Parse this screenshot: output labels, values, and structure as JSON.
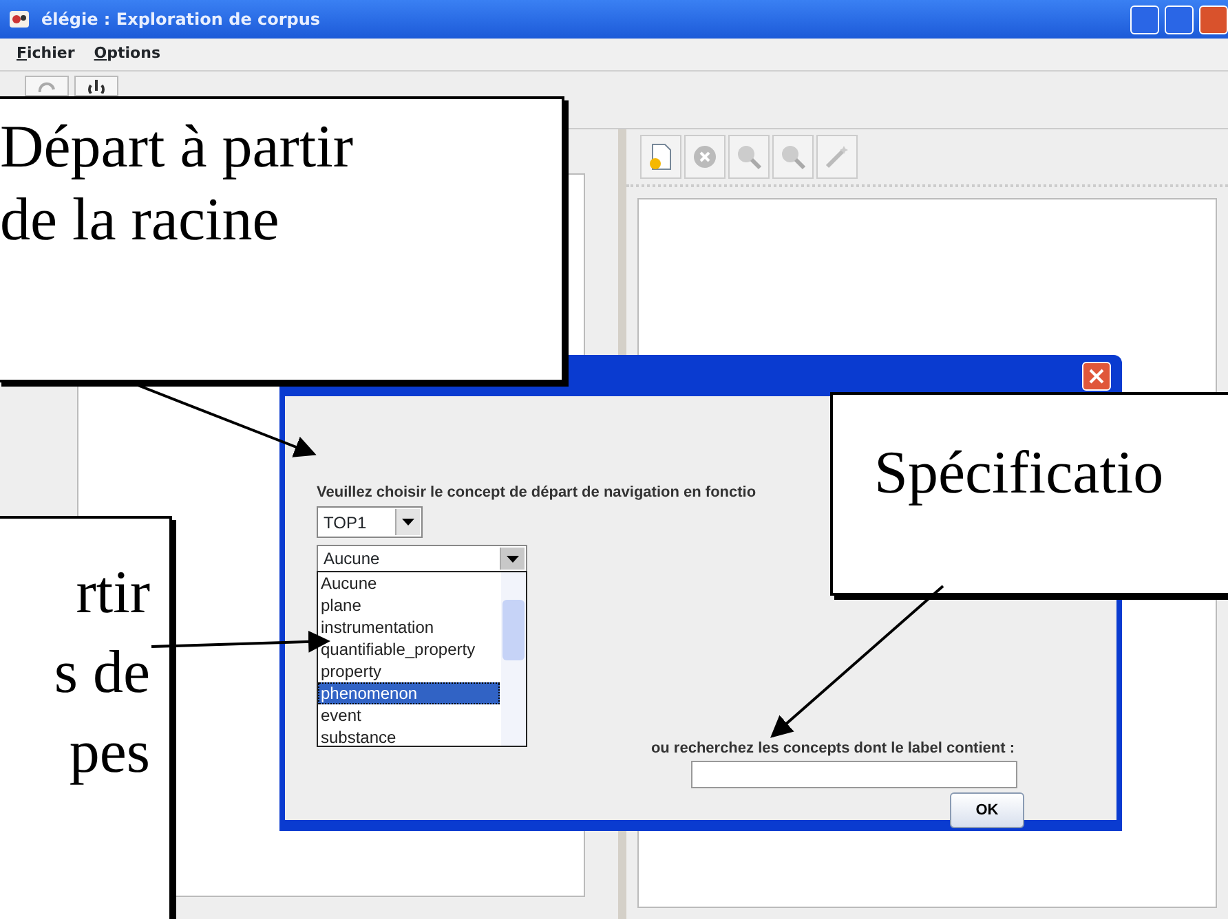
{
  "window": {
    "title": "élégie : Exploration de corpus"
  },
  "menu": [
    {
      "label": "Fichier"
    },
    {
      "label": "Options"
    }
  ],
  "dialog": {
    "prompt": "Veuillez choisir le concept de départ de navigation en fonctio",
    "root_combo": {
      "value": "TOP1"
    },
    "type_combo": {
      "value": "Aucune",
      "expanded": true
    },
    "type_options": [
      {
        "label": "Aucune",
        "selected": false
      },
      {
        "label": "plane",
        "selected": false
      },
      {
        "label": "instrumentation",
        "selected": false
      },
      {
        "label": "quantifiable_property",
        "selected": false
      },
      {
        "label": "property",
        "selected": false
      },
      {
        "label": "phenomenon",
        "selected": true
      },
      {
        "label": "event",
        "selected": false
      },
      {
        "label": "substance",
        "selected": false
      }
    ],
    "search_label": "ou recherchez les concepts dont le label contient :",
    "ok_button": "OK"
  },
  "callouts": [
    {
      "lines": [
        "Départ à partir",
        "de la racine"
      ]
    },
    {
      "lines": [
        "Spécificatio"
      ]
    },
    {
      "lines": [
        "rtir",
        "s de",
        "pes"
      ]
    }
  ]
}
